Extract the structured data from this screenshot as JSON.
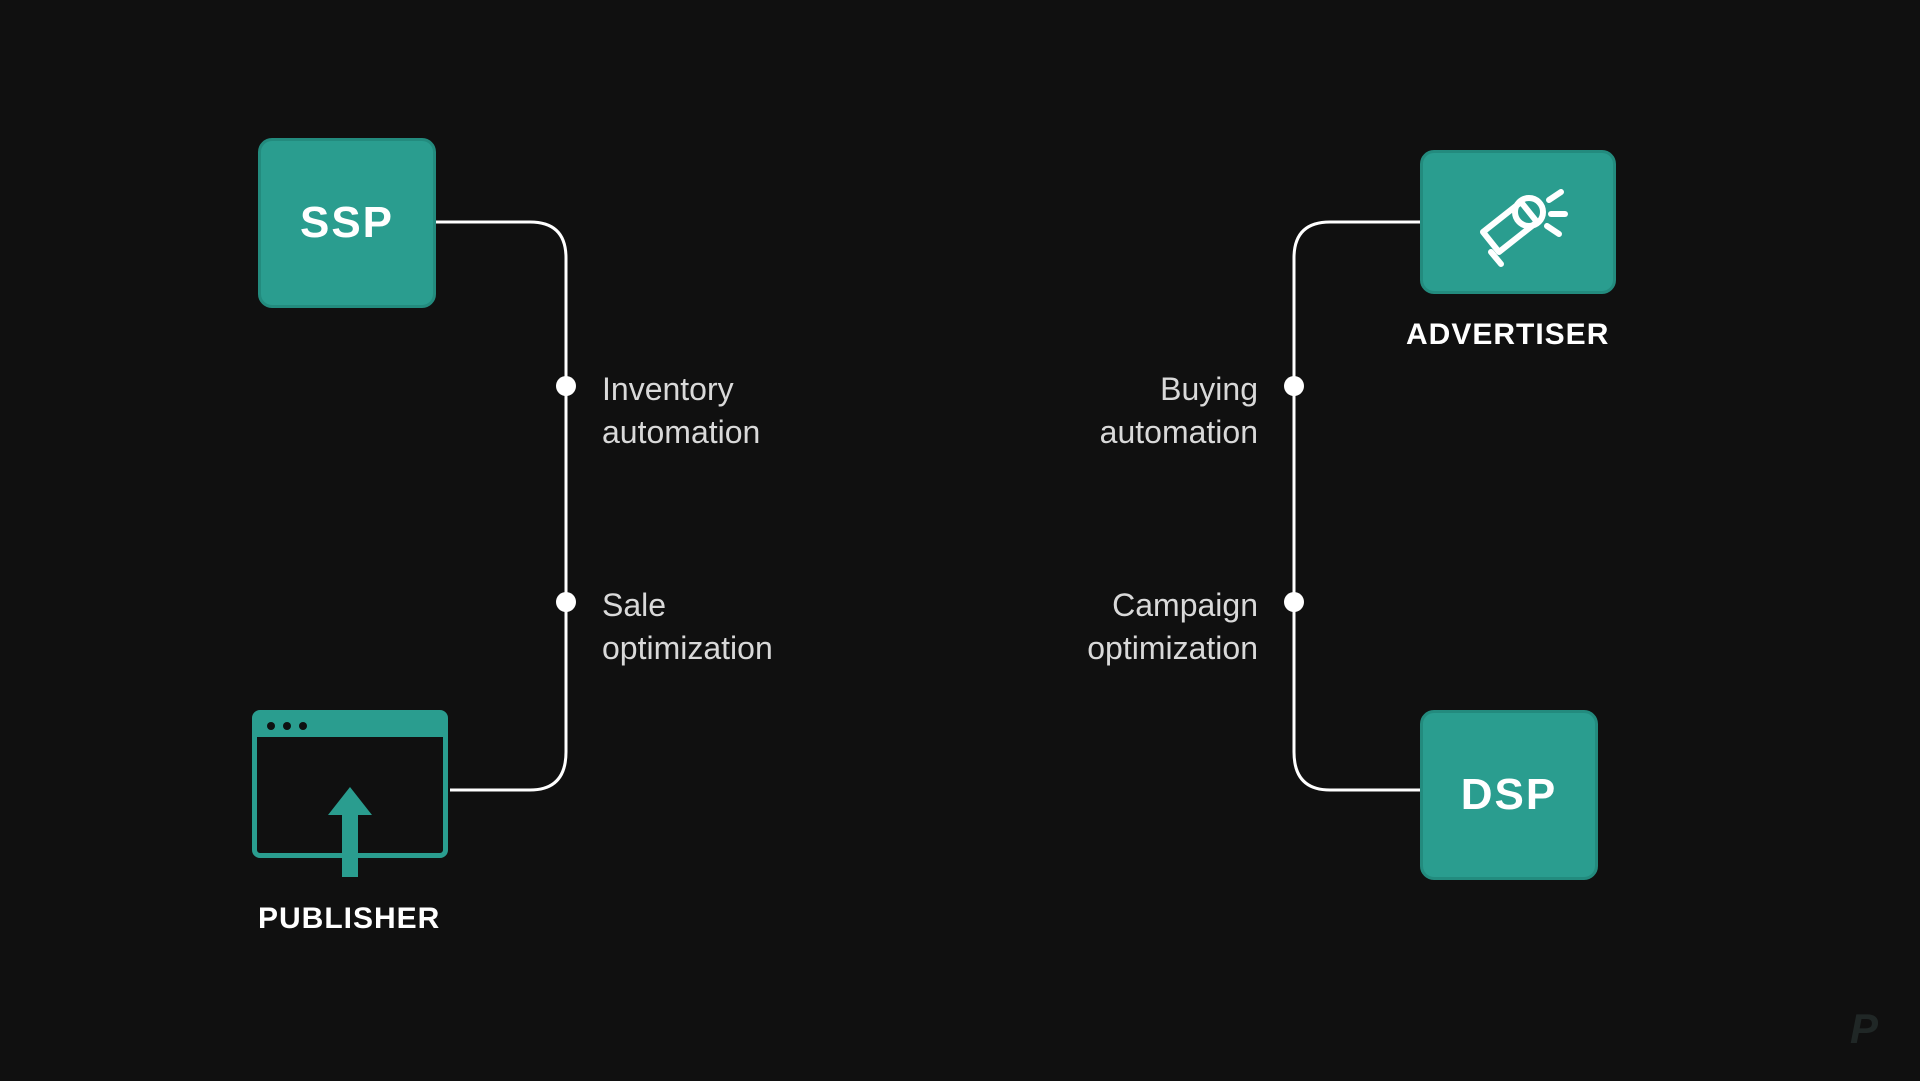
{
  "colors": {
    "background": "#101010",
    "accent": "#2a9d8f",
    "text": "#d9d9d9",
    "white": "#ffffff"
  },
  "nodes": {
    "ssp": {
      "label": "SSP"
    },
    "dsp": {
      "label": "DSP"
    },
    "advertiser": {
      "caption": "ADVERTISER"
    },
    "publisher": {
      "caption": "PUBLISHER"
    }
  },
  "left_path": {
    "point1": {
      "line1": "Inventory",
      "line2": "automation"
    },
    "point2": {
      "line1": "Sale",
      "line2": "optimization"
    }
  },
  "right_path": {
    "point1": {
      "line1": "Buying",
      "line2": "automation"
    },
    "point2": {
      "line1": "Campaign",
      "line2": "optimization"
    }
  },
  "logo": "P"
}
